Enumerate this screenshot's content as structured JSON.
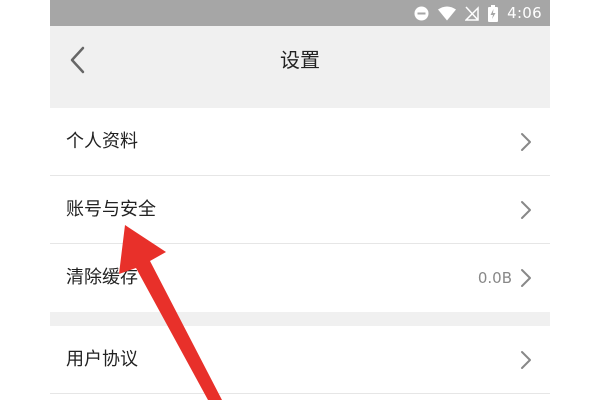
{
  "status_bar": {
    "time": "4:06",
    "icons": [
      "do-not-disturb-icon",
      "wifi-icon",
      "no-sim-icon",
      "battery-charging-icon"
    ]
  },
  "header": {
    "title": "设置",
    "back_icon": "chevron-left-icon"
  },
  "settings": {
    "items": [
      {
        "label": "个人资料"
      },
      {
        "label": "账号与安全"
      },
      {
        "label": "清除缓存",
        "value": "0.0B"
      },
      {
        "label": "用户协议"
      }
    ]
  },
  "colors": {
    "status_bar": "#a6a6a6",
    "header_bg": "#f0f0f0",
    "annotation_arrow": "#e8302a"
  }
}
